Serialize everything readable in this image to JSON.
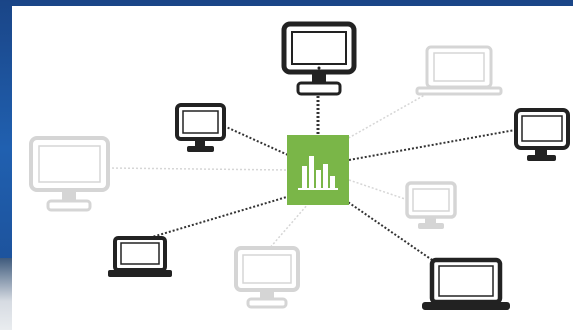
{
  "diagram": {
    "hub": {
      "icon": "bar-chart-icon",
      "color": "#7ab648"
    },
    "colors": {
      "dark_device": "#222222",
      "light_device": "#d5d5d5",
      "dark_link": "#333333",
      "light_link": "#cfcfcf",
      "background": "#1f4f93"
    },
    "devices": [
      {
        "name": "monitor-top-center",
        "kind": "monitor",
        "style": "dark"
      },
      {
        "name": "laptop-top-right",
        "kind": "laptop",
        "style": "light"
      },
      {
        "name": "monitor-small-left",
        "kind": "monitor",
        "style": "dark"
      },
      {
        "name": "monitor-right",
        "kind": "monitor",
        "style": "dark"
      },
      {
        "name": "monitor-far-left",
        "kind": "monitor",
        "style": "light"
      },
      {
        "name": "monitor-small-right",
        "kind": "monitor",
        "style": "light"
      },
      {
        "name": "laptop-bottom-left",
        "kind": "laptop",
        "style": "dark"
      },
      {
        "name": "monitor-bottom-center",
        "kind": "monitor",
        "style": "light"
      },
      {
        "name": "laptop-bottom-right",
        "kind": "laptop",
        "style": "dark"
      }
    ]
  }
}
